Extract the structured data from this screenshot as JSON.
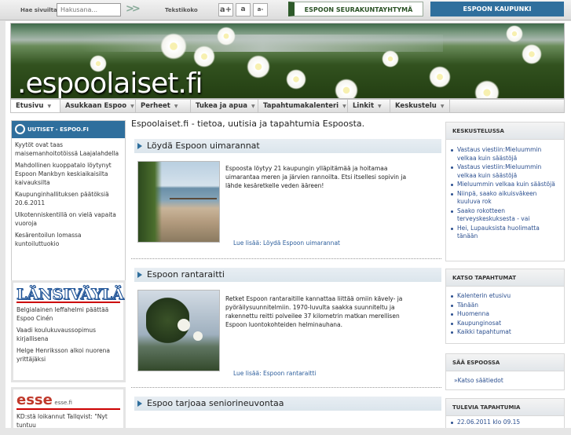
{
  "topbar": {
    "search_label": "Hae sivuilta",
    "search_placeholder": "Hakusana...",
    "search_go": ">>",
    "text_size_label": "Tekstikoko",
    "font_sizes": [
      "a+",
      "a",
      "a-"
    ],
    "tab_left": "ESPOON SEURAKUNTAYHTYMÄ",
    "tab_right": "ESPOON KAUPUNKI"
  },
  "banner": {
    "logo": ".espoolaiset.fi"
  },
  "nav": {
    "items": [
      {
        "label": "Etusivu",
        "arrow": "▼"
      },
      {
        "label": "Asukkaan Espoo",
        "arrow": "▼"
      },
      {
        "label": "Perheet",
        "arrow": "▼"
      },
      {
        "label": "Tukea ja apua",
        "arrow": "▼"
      },
      {
        "label": "Tapahtumakalenteri",
        "arrow": "▼"
      },
      {
        "label": "Linkit",
        "arrow": "▼"
      },
      {
        "label": "Keskustelu",
        "arrow": "▼"
      }
    ]
  },
  "left": {
    "uutiset": {
      "title": "UUTISET - ESPOO.FI",
      "items": [
        "Kyytöt ovat taas maisemanhoitotöissä Laajalahdella",
        "Mahdollinen kuoppatalo löytynyt Espoon Mankbyn keskiaikaisilta kaivauksilta",
        "Kaupunginhallituksen päätöksiä 20.6.2011",
        "Ulkotenniskentillä on vielä vapaita vuoroja",
        "Kesärentoilun lomassa kuntoiluttuokio"
      ]
    },
    "lansivayla": {
      "logo": "LÄNSIVÄYLÄ",
      "items": [
        "Belgialainen leffahelmi päättää Espoo Cinén",
        "Vaadi koulukuvaussopimus kirjallisena",
        "Helge Henriksson alkoi nuorena yrittäjäksi"
      ]
    },
    "esse": {
      "logo": "esse",
      "logo_small": "esse.fi",
      "items": [
        "KD:stä loikannut Tallqvist: \"Nyt tuntuu"
      ]
    }
  },
  "center": {
    "page_title": "Espoolaiset.fi - tietoa, uutisia ja tapahtumia Espoosta.",
    "articles": [
      {
        "title": "Löydä Espoon uimarannat",
        "text": "Espoosta löytyy 21 kaupungin ylläpitämää ja hoitamaa uimarantaa meren ja järvien rannoilta. Etsi itsellesi sopivin ja lähde kesäretkelle veden ääreen!",
        "more": "Lue lisää: Löydä Espoon uimarannat"
      },
      {
        "title": "Espoon rantaraitti",
        "text": "Retket Espoon rantaraitille kannattaa liittää omiin kävely- ja pyöräilysuunnitelmiin. 1970-luvulta saakka suunniteltu ja rakennettu reitti polveilee 37 kilometrin matkan merellisen Espoon luontokohteiden helminauhana.",
        "more": "Lue lisää: Espoon rantaraitti"
      },
      {
        "title": "Espoo tarjoaa seniorineuvontaa"
      }
    ]
  },
  "right": {
    "keskustelussa": {
      "title": "KESKUSTELUSSA",
      "items": [
        "Vastaus viestiin:Mieluummin velkaa kuin säästöjä",
        "Vastaus viestiin:Mieluummin velkaa kuin säästöjä",
        "Mieluummin velkaa kuin säästöjä",
        "Niinpä, saako aikuisväkeen kuuluva rok",
        "Saako rokotteen terveyskeskuksesta - vai",
        "Hei, Lupauksista huolimatta tänään"
      ]
    },
    "tapahtumat": {
      "title": "KATSO TAPAHTUMAT",
      "items": [
        "Kalenterin etusivu",
        "Tänään",
        "Huomenna",
        "Kaupunginosat",
        "Kaikki tapahtumat"
      ]
    },
    "saa": {
      "title": "SÄÄ ESPOOSSA",
      "link": "»Katso säätiedot"
    },
    "tulevia": {
      "title": "TULEVIA TAPAHTUMIA",
      "items": [
        "22.06.2011 klo 09.15"
      ]
    }
  }
}
